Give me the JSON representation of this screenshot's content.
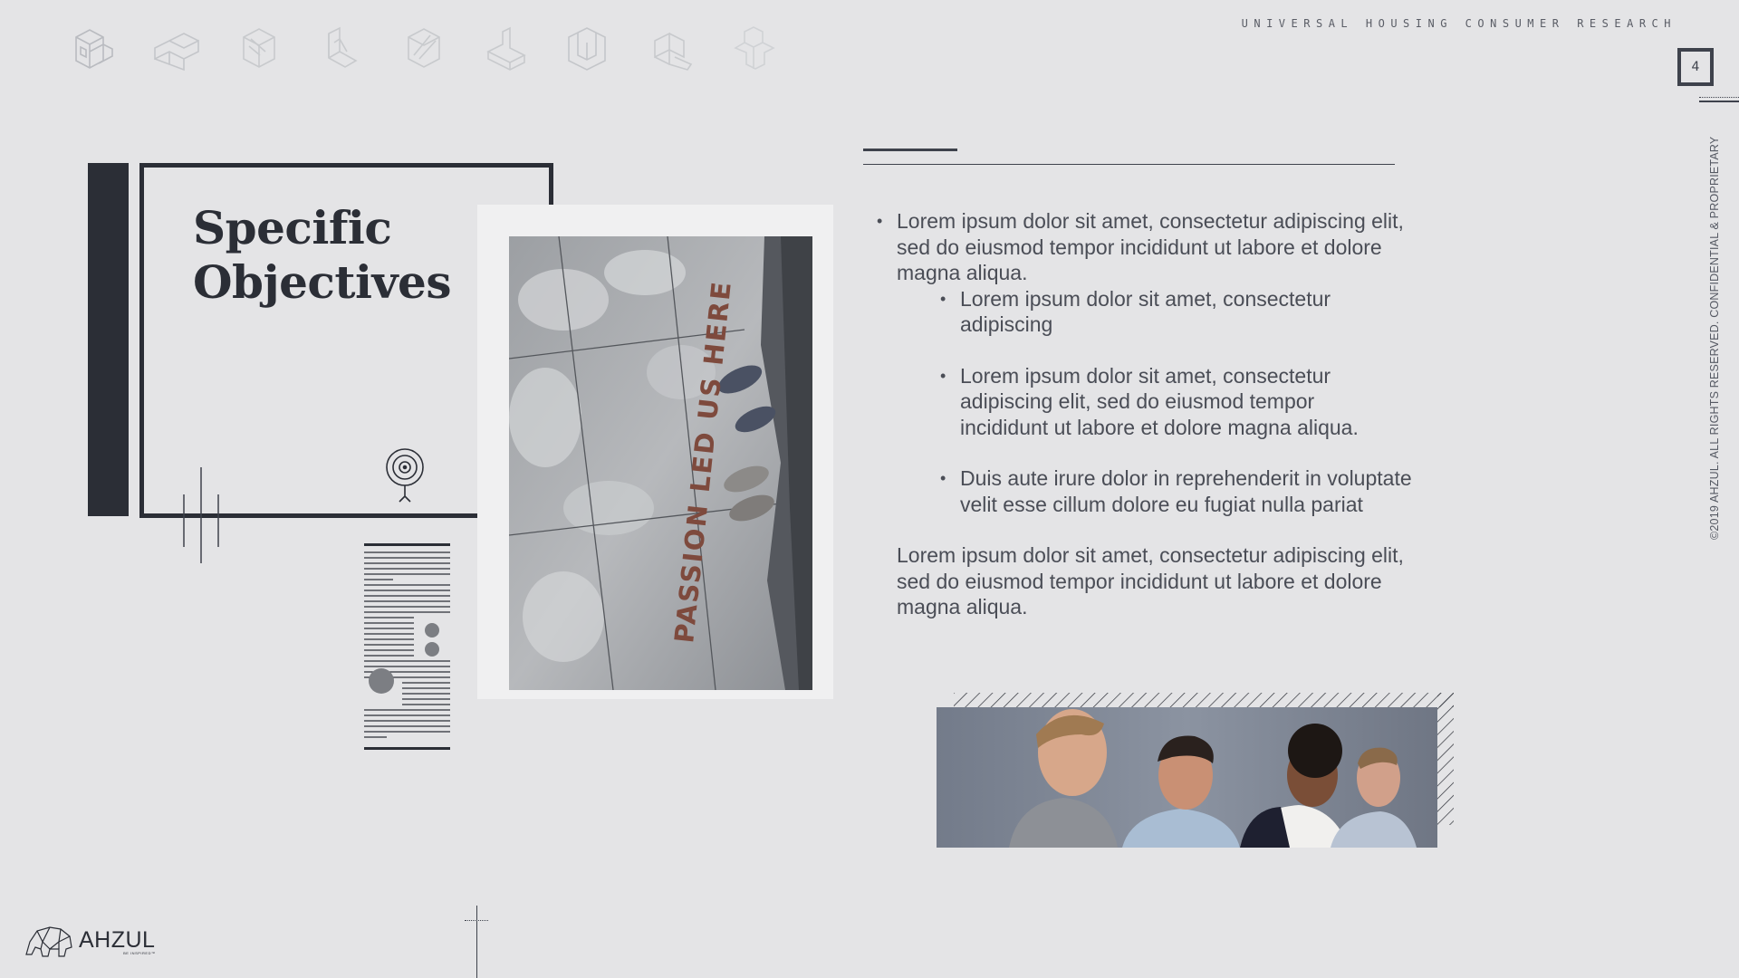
{
  "header": {
    "title": "UNIVERSAL HOUSING CONSUMER RESEARCH",
    "page_number": "4"
  },
  "sidebar": {
    "copyright": "©2019 AHZUL. ALL RIGHTS RESERVED. CONFIDENTIAL & PROPRIETARY"
  },
  "icons": [
    "isometric-block-icon-1",
    "isometric-block-icon-2",
    "isometric-block-icon-3",
    "isometric-block-icon-4",
    "isometric-block-icon-5",
    "isometric-block-icon-6",
    "isometric-block-icon-7",
    "isometric-block-icon-8",
    "isometric-block-icon-9"
  ],
  "title": {
    "line1": "Specific",
    "line2": "Objectives"
  },
  "photo": {
    "caption": "PASSION LED US HERE"
  },
  "body": {
    "bullet1": "Lorem ipsum dolor sit amet, consectetur adipiscing elit, sed do eiusmod tempor incididunt ut labore et dolore magna aliqua.",
    "sub1": "Lorem ipsum dolor sit amet, consectetur adipiscing",
    "sub2": "Lorem ipsum dolor sit amet, consectetur adipiscing elit, sed do eiusmod tempor incididunt ut labore et dolore magna aliqua.",
    "sub3": "Duis aute irure dolor in reprehenderit in voluptate velit esse cillum dolore eu fugiat nulla pariat",
    "paragraph": "Lorem ipsum dolor sit amet, consectetur adipiscing elit, sed do eiusmod tempor incididunt ut labore et dolore magna aliqua."
  },
  "footer": {
    "logo_text": "AHZUL",
    "logo_tagline": "BE INSPIRED™"
  },
  "colors": {
    "background": "#e4e4e6",
    "dark": "#2b2e36",
    "text": "#4a4d56"
  }
}
